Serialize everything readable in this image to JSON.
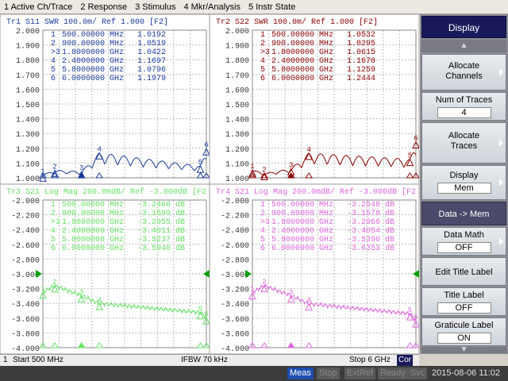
{
  "menu": [
    "1 Active Ch/Trace",
    "2 Response",
    "3 Stimulus",
    "4 Mkr/Analysis",
    "5 Instr State"
  ],
  "colors": {
    "tr1": "#1a3a9a",
    "tr2": "#8b0000",
    "tr3": "#66e066",
    "tr4": "#dd66dd",
    "grid": "#bdbdbd",
    "ref_marker": "#00a000"
  },
  "panels": [
    {
      "id": "tr1",
      "header": "Tr1 S11 SWR 100.0m/ Ref 1.000 [F2]",
      "ticks": [
        "2.000",
        "1.900",
        "1.800",
        "1.700",
        "1.600",
        "1.500",
        "1.400",
        "1.300",
        "1.200",
        "1.100",
        "1.000"
      ],
      "color": "#1a3a9a",
      "markers": [
        {
          "n": "1",
          "f": "500.00000 MHz",
          "v": "1.0192"
        },
        {
          "n": "2",
          "f": "900.00000 MHz",
          "v": "1.0519"
        },
        {
          "n": ">3",
          "f": "1.8000000 GHz",
          "v": "1.0422"
        },
        {
          "n": "4",
          "f": "2.4000000 GHz",
          "v": "1.1697"
        },
        {
          "n": "5",
          "f": "5.8000000 GHz",
          "v": "1.0796"
        },
        {
          "n": "6",
          "f": "6.0000000 GHz",
          "v": "1.1979"
        }
      ]
    },
    {
      "id": "tr2",
      "header": "Tr2 S22 SWR 100.0m/ Ref 1.000 [F2]",
      "ticks": [
        "2.000",
        "1.900",
        "1.800",
        "1.700",
        "1.600",
        "1.500",
        "1.400",
        "1.300",
        "1.200",
        "1.100",
        "1.000"
      ],
      "color": "#8b0000",
      "markers": [
        {
          "n": "1",
          "f": "500.00000 MHz",
          "v": "1.0532"
        },
        {
          "n": "2",
          "f": "900.00000 MHz",
          "v": "1.0295"
        },
        {
          "n": ">3",
          "f": "1.8000000 GHz",
          "v": "1.0615"
        },
        {
          "n": "4",
          "f": "2.4000000 GHz",
          "v": "1.1670"
        },
        {
          "n": "5",
          "f": "5.8000000 GHz",
          "v": "1.1259"
        },
        {
          "n": "6",
          "f": "6.0000000 GHz",
          "v": "1.2444"
        }
      ]
    },
    {
      "id": "tr3",
      "header": "Tr3 S21 Log Mag 200.0mdB/ Ref -3.000dB [F2",
      "ticks": [
        "-2.000",
        "-2.200",
        "-2.400",
        "-2.600",
        "-2.800",
        "-3.000",
        "-3.200",
        "-3.400",
        "-3.600",
        "-3.800",
        "-4.000"
      ],
      "color": "#66e066",
      "markers": [
        {
          "n": "1",
          "f": "500.00000 MHz",
          "v": "-3.2466 dB"
        },
        {
          "n": "2",
          "f": "900.00000 MHz",
          "v": "-3.1599 dB"
        },
        {
          "n": ">3",
          "f": "1.8000000 GHz",
          "v": "-3.2955 dB"
        },
        {
          "n": "4",
          "f": "2.4000000 GHz",
          "v": "-3.4011 dB"
        },
        {
          "n": "5",
          "f": "5.8000000 GHz",
          "v": "-3.5237 dB"
        },
        {
          "n": "6",
          "f": "6.0000000 GHz",
          "v": "-3.5940 dB"
        }
      ]
    },
    {
      "id": "tr4",
      "header": "Tr4 S21 Log Mag 200.0mdB/ Ref -3.000dB [F2",
      "ticks": [
        "-2.000",
        "-2.200",
        "-2.400",
        "-2.600",
        "-2.800",
        "-3.000",
        "-3.200",
        "-3.400",
        "-3.600",
        "-3.800",
        "-4.000"
      ],
      "color": "#dd66dd",
      "markers": [
        {
          "n": "1",
          "f": "500.00000 MHz",
          "v": "-3.2548 dB"
        },
        {
          "n": "2",
          "f": "900.00000 MHz",
          "v": "-3.1578 dB"
        },
        {
          "n": ">3",
          "f": "1.8000000 GHz",
          "v": "-3.2966 dB"
        },
        {
          "n": "4",
          "f": "2.4000000 GHz",
          "v": "-3.4054 dB"
        },
        {
          "n": "5",
          "f": "5.8000000 GHz",
          "v": "-3.5390 dB"
        },
        {
          "n": "6",
          "f": "6.0000000 GHz",
          "v": "-3.6353 dB"
        }
      ]
    }
  ],
  "side_menu": {
    "title": "Display",
    "allocate_channels": "Allocate Channels",
    "num_traces_label": "Num of Traces",
    "num_traces_value": "4",
    "allocate_traces": "Allocate Traces",
    "display_label": "Display",
    "display_value": "Mem",
    "data_mem": "Data -> Mem",
    "data_math_label": "Data Math",
    "data_math_value": "OFF",
    "edit_title": "Edit Title Label",
    "title_label": "Title Label",
    "title_label_value": "OFF",
    "graticule_label": "Graticule Label",
    "graticule_value": "ON"
  },
  "status": {
    "channel": "1",
    "start": "Start 500 MHz",
    "ifbw": "IFBW 70 kHz",
    "stop": "Stop 6 GHz",
    "cor": "Cor"
  },
  "bottom": {
    "meas": "Meas",
    "stop": "Stop",
    "extref": "ExtRef",
    "ready": "Ready",
    "svc": "Svc",
    "datetime": "2015-08-06 11:02"
  },
  "chart_data": [
    {
      "type": "line",
      "title": "Tr1 S11 SWR 100.0m/ Ref 1.000 [F2]",
      "x": [
        0.5,
        0.9,
        1.8,
        2.4,
        5.8,
        6.0
      ],
      "series": [
        {
          "values": [
            1.0192,
            1.0519,
            1.0422,
            1.1697,
            1.0796,
            1.1979
          ]
        }
      ],
      "ylim": [
        1.0,
        2.0
      ],
      "grid": true
    },
    {
      "type": "line",
      "title": "Tr2 S22 SWR 100.0m/ Ref 1.000 [F2]",
      "x": [
        0.5,
        0.9,
        1.8,
        2.4,
        5.8,
        6.0
      ],
      "series": [
        {
          "values": [
            1.0532,
            1.0295,
            1.0615,
            1.167,
            1.1259,
            1.2444
          ]
        }
      ],
      "ylim": [
        1.0,
        2.0
      ],
      "grid": true
    },
    {
      "type": "line",
      "title": "Tr3 S21 Log Mag 200.0mdB/ Ref -3.000dB [F2",
      "x": [
        0.5,
        0.9,
        1.8,
        2.4,
        5.8,
        6.0
      ],
      "series": [
        {
          "values": [
            -3.2466,
            -3.1599,
            -3.2955,
            -3.4011,
            -3.5237,
            -3.594
          ]
        }
      ],
      "ylim": [
        -4.0,
        -2.0
      ],
      "grid": true
    },
    {
      "type": "line",
      "title": "Tr4 S21 Log Mag 200.0mdB/ Ref -3.000dB [F2",
      "x": [
        0.5,
        0.9,
        1.8,
        2.4,
        5.8,
        6.0
      ],
      "series": [
        {
          "values": [
            -3.2548,
            -3.1578,
            -3.2966,
            -3.4054,
            -3.539,
            -3.6353
          ]
        }
      ],
      "ylim": [
        -4.0,
        -2.0
      ],
      "grid": true
    }
  ]
}
